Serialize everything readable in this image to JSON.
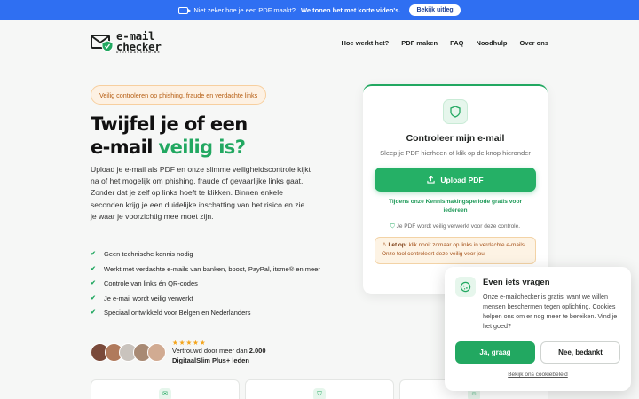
{
  "topbar": {
    "icon": "video-icon",
    "text": "Niet zeker hoe je een PDF maakt?",
    "bold_text": "We tonen het met korte video's.",
    "button": "Bekijk uitleg"
  },
  "header": {
    "logo": {
      "line1": "e-mail",
      "line2": "checker",
      "tagline": "DIGITAALSLIM.BE"
    },
    "nav": [
      "Hoe werkt het?",
      "PDF maken",
      "FAQ",
      "Noodhulp",
      "Over ons"
    ]
  },
  "hero": {
    "badge": "Veilig controleren op phishing, fraude en verdachte links",
    "title_line1": "Twijfel je of een",
    "title_line2_a": "e-mail ",
    "title_line2_b": "veilig is?",
    "lead": "Upload je e-mail als PDF en onze slimme veiligheidscontrole kijkt na of het mogelijk om phishing, fraude of gevaarlijke links gaat. Zonder dat je zelf op links hoeft te klikken. Binnen enkele seconden krijg je een duidelijke inschatting van het risico en zie je waar je voorzichtig mee moet zijn.",
    "checks": [
      "Geen technische kennis nodig",
      "Werkt met verdachte e-mails van banken, bpost, PayPal, itsme® en meer",
      "Controle van links én QR-codes",
      "Je e-mail wordt veilig verwerkt",
      "Speciaal ontwikkeld voor Belgen en Nederlanders"
    ],
    "stars": "★★★★★",
    "trust_text": "Vertrouwd door meer dan ",
    "trust_count": "2.000",
    "trust_text2": "DigitaalSlim Plus+ leden"
  },
  "upload_card": {
    "title": "Controleer mijn e-mail",
    "subtitle": "Sleep je PDF hierheen of klik op de knop hieronder",
    "button": "Upload PDF",
    "promo": "Tijdens onze Kennismakingsperiode gratis voor iedereen",
    "safe_note": "Je PDF wordt veilig verwerkt voor deze controle.",
    "warn_label": "Let op:",
    "warn_text": "klik nooit zomaar op links in verdachte e-mails. Onze tool controleert deze veilig voor jou."
  },
  "cookie": {
    "title": "Even iets vragen",
    "text": "Onze e-mailchecker is gratis, want we willen mensen beschermen tegen oplichting. Cookies helpen ons om er nog meer te bereiken. Vind je het goed?",
    "accept": "Ja, graag",
    "decline": "Nee, bedankt",
    "link": "Bekijk ons cookiebeleid"
  },
  "colors": {
    "brand_green": "#22a861",
    "topbar_blue": "#2f6ff2",
    "warning_orange": "#f7cf9f"
  }
}
